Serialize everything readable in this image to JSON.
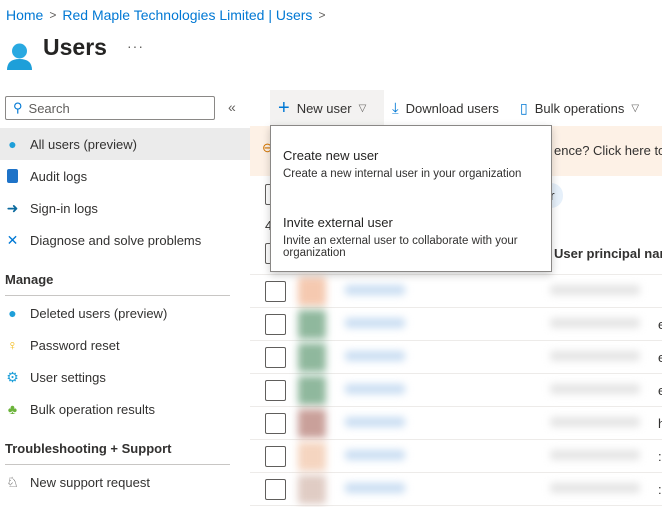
{
  "breadcrumb": [
    "Home",
    "Red Maple Technologies Limited | Users"
  ],
  "page": {
    "title": "Users",
    "more": "···"
  },
  "sidebar": {
    "search_placeholder": "Search",
    "collapse": "«",
    "items": [
      {
        "label": "All users (preview)",
        "icon": "user-icon",
        "selected": true
      },
      {
        "label": "Audit logs",
        "icon": "audit-log-icon"
      },
      {
        "label": "Sign-in logs",
        "icon": "sign-in-icon"
      },
      {
        "label": "Diagnose and solve problems",
        "icon": "wrench-icon"
      }
    ],
    "manage_header": "Manage",
    "manage_items": [
      {
        "label": "Deleted users (preview)",
        "icon": "deleted-user-icon"
      },
      {
        "label": "Password reset",
        "icon": "key-icon"
      },
      {
        "label": "User settings",
        "icon": "user-settings-icon"
      },
      {
        "label": "Bulk operation results",
        "icon": "bulk-results-icon"
      }
    ],
    "support_header": "Troubleshooting + Support",
    "support_items": [
      {
        "label": "New support request",
        "icon": "support-icon"
      }
    ]
  },
  "toolbar": {
    "new_user": "New user",
    "download_users": "Download users",
    "bulk_operations": "Bulk operations"
  },
  "banner": {
    "text": "ence? Click here to le"
  },
  "filter_pill": "er",
  "count_partial": "4",
  "table": {
    "column_upn": "User principal nam",
    "row_edge_chars": [
      "",
      "e",
      "e",
      "e",
      "h",
      ":",
      ":"
    ]
  },
  "dropdown": {
    "items": [
      {
        "title": "Create new user",
        "desc": "Create a new internal user in your organization"
      },
      {
        "title": "Invite external user",
        "desc": "Invite an external user to collaborate with your organization"
      }
    ]
  },
  "colors": {
    "accent": "#0078d4",
    "banner": "#fdf1e6",
    "selected": "#ebebeb"
  }
}
